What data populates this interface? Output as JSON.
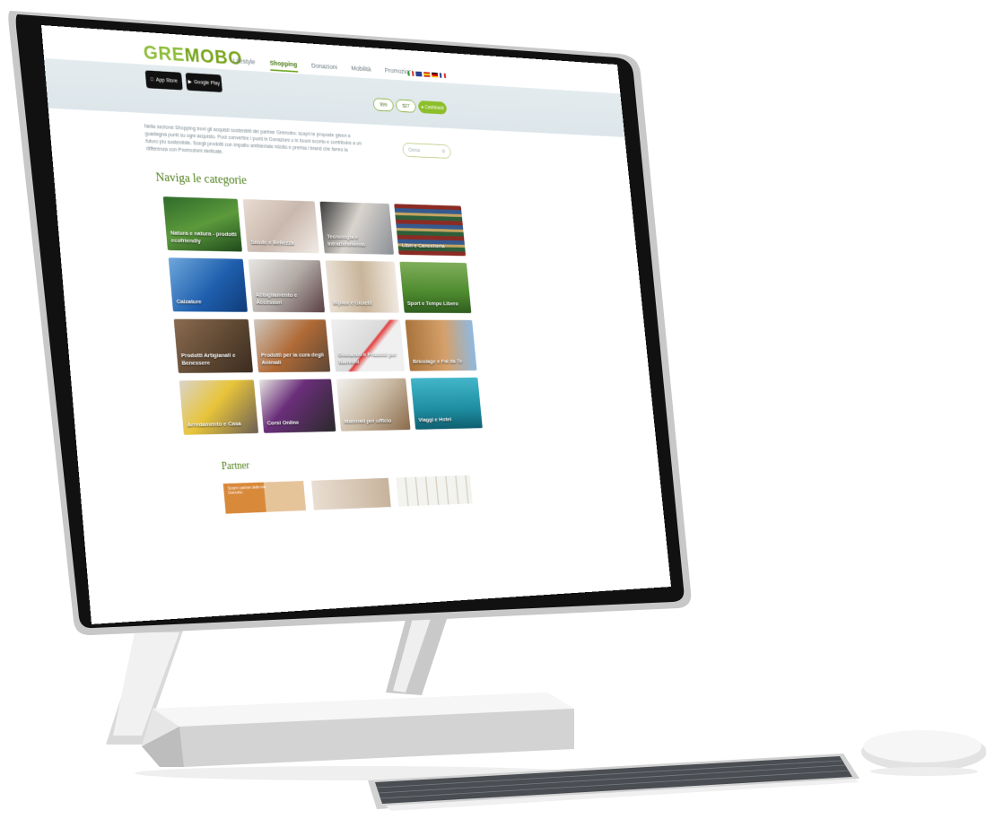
{
  "brand": {
    "logo_part1": "GRE",
    "logo_part2": "MOBO"
  },
  "header": {
    "nav": [
      "Lifestyle",
      "Shopping",
      "Donazioni",
      "Mobilità",
      "Promozioni"
    ],
    "active_nav": "Shopping",
    "app_store": "App Store",
    "google_play": "Google Play",
    "points_1": "999",
    "points_2": "527",
    "account_button": "Cashback",
    "flags": [
      "it",
      "gb",
      "es",
      "de",
      "fr"
    ]
  },
  "intro": {
    "text": "Nella sezione Shopping trovi gli acquisti sostenibili dei partner Gremobo: scopri le proposte green e guadagna punti su ogni acquisto. Puoi convertire i punti in Donazioni o in buoni sconto e contribuire a un futuro più sostenibile. Scegli prodotti con impatto ambientale ridotto e premia i brand che fanno la differenza con Promozioni dedicate."
  },
  "search": {
    "placeholder": "Cerca"
  },
  "categories_title": "Naviga le categorie",
  "categories": [
    "Natura e natura - prodotti ecofriendly",
    "Salute e Bellezza",
    "Tecnologia e Intrattenimento",
    "Libri e Cancelleria",
    "Calzature",
    "Abbigliamento e Accessori",
    "Bijoux e Gioielli",
    "Sport e Tempo Libero",
    "Prodotti Artigianali e Benessere",
    "Prodotti per la cura degli Animali",
    "Giocattoli e Prodotti per Bambini",
    "Bricolage e Fai da Te",
    "Arredamento e Casa",
    "Corsi Online",
    "Materiali per ufficio",
    "Viaggi e Hotel"
  ],
  "partner_title": "Partner",
  "partner_note": "Scopri i partner della rete Gremobo",
  "colors": {
    "brand_green": "#7aa61f",
    "title_green": "#4a7d14",
    "header_band": "#dde6ea"
  }
}
